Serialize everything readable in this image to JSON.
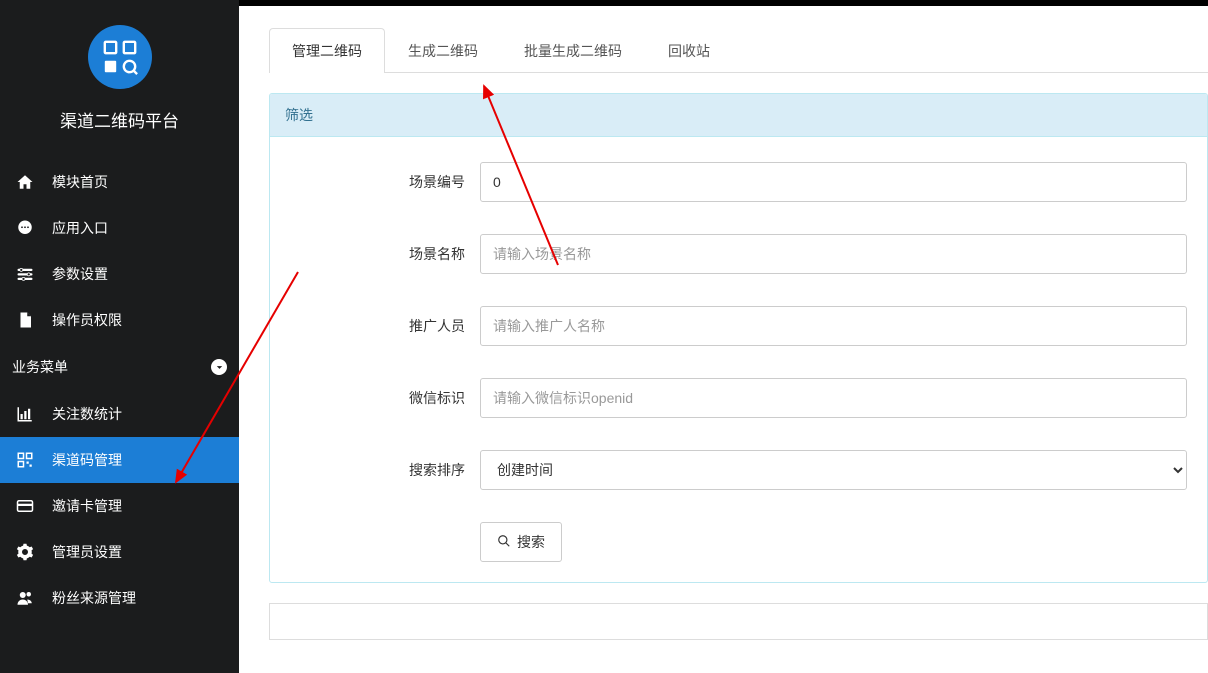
{
  "app": {
    "title": "渠道二维码平台"
  },
  "sidebar": {
    "items": [
      {
        "label": "模块首页",
        "icon": "home-icon"
      },
      {
        "label": "应用入口",
        "icon": "chat-icon"
      },
      {
        "label": "参数设置",
        "icon": "sliders-icon"
      },
      {
        "label": "操作员权限",
        "icon": "file-icon"
      }
    ],
    "section_label": "业务菜单",
    "sub_items": [
      {
        "label": "关注数统计",
        "icon": "bar-chart-icon"
      },
      {
        "label": "渠道码管理",
        "icon": "qr-icon",
        "active": true
      },
      {
        "label": "邀请卡管理",
        "icon": "card-icon"
      },
      {
        "label": "管理员设置",
        "icon": "gear-icon"
      },
      {
        "label": "粉丝来源管理",
        "icon": "users-icon"
      }
    ]
  },
  "tabs": [
    {
      "label": "管理二维码",
      "active": true
    },
    {
      "label": "生成二维码"
    },
    {
      "label": "批量生成二维码"
    },
    {
      "label": "回收站"
    }
  ],
  "filter": {
    "header": "筛选",
    "scene_id_label": "场景编号",
    "scene_id_value": "0",
    "scene_name_label": "场景名称",
    "scene_name_placeholder": "请输入场景名称",
    "promoter_label": "推广人员",
    "promoter_placeholder": "请输入推广人名称",
    "wechat_label": "微信标识",
    "wechat_placeholder": "请输入微信标识openid",
    "sort_label": "搜索排序",
    "sort_value": "创建时间",
    "search_button": "搜索"
  }
}
